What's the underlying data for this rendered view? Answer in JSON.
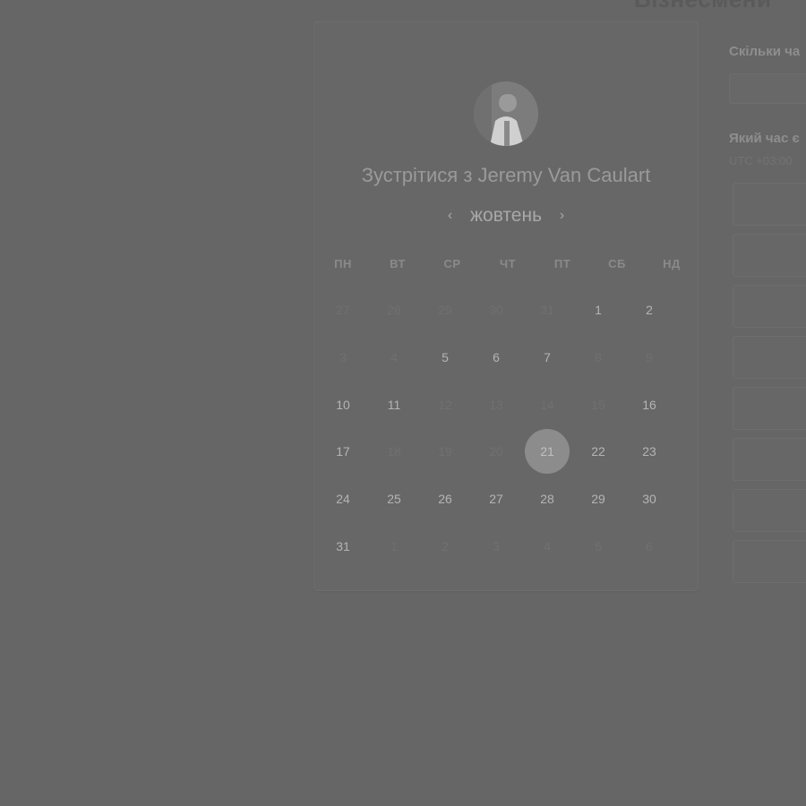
{
  "header": {
    "title": "Бізнесмени"
  },
  "host": {
    "meet_prefix": "Зустрітися з",
    "name": "Jeremy Van Caulart"
  },
  "calendar": {
    "month": "жовтень",
    "prev_icon": "chevron-left-icon",
    "next_icon": "chevron-right-icon",
    "weekdays": [
      "ПН",
      "ВТ",
      "СР",
      "ЧТ",
      "ПТ",
      "СБ",
      "НД"
    ],
    "selected_day": "21",
    "weeks": [
      [
        {
          "d": "27",
          "a": false
        },
        {
          "d": "28",
          "a": false
        },
        {
          "d": "29",
          "a": false
        },
        {
          "d": "30",
          "a": false
        },
        {
          "d": "31",
          "a": false
        },
        {
          "d": "1",
          "a": true
        },
        {
          "d": "2",
          "a": true
        }
      ],
      [
        {
          "d": "3",
          "a": false
        },
        {
          "d": "4",
          "a": false
        },
        {
          "d": "5",
          "a": true
        },
        {
          "d": "6",
          "a": true
        },
        {
          "d": "7",
          "a": true
        },
        {
          "d": "8",
          "a": false
        },
        {
          "d": "9",
          "a": false
        }
      ],
      [
        {
          "d": "10",
          "a": true
        },
        {
          "d": "11",
          "a": true
        },
        {
          "d": "12",
          "a": false
        },
        {
          "d": "13",
          "a": false
        },
        {
          "d": "14",
          "a": false
        },
        {
          "d": "15",
          "a": false
        },
        {
          "d": "16",
          "a": true
        }
      ],
      [
        {
          "d": "17",
          "a": true
        },
        {
          "d": "18",
          "a": false
        },
        {
          "d": "19",
          "a": false
        },
        {
          "d": "20",
          "a": false
        },
        {
          "d": "21",
          "a": true
        },
        {
          "d": "22",
          "a": true
        },
        {
          "d": "23",
          "a": true
        }
      ],
      [
        {
          "d": "24",
          "a": true
        },
        {
          "d": "25",
          "a": true
        },
        {
          "d": "26",
          "a": true
        },
        {
          "d": "27",
          "a": true
        },
        {
          "d": "28",
          "a": true
        },
        {
          "d": "29",
          "a": true
        },
        {
          "d": "30",
          "a": true
        }
      ],
      [
        {
          "d": "31",
          "a": true
        },
        {
          "d": "1",
          "a": false
        },
        {
          "d": "2",
          "a": false
        },
        {
          "d": "3",
          "a": false
        },
        {
          "d": "4",
          "a": false
        },
        {
          "d": "5",
          "a": false
        },
        {
          "d": "6",
          "a": false
        }
      ]
    ]
  },
  "booking": {
    "duration_question": "Скільки ча",
    "time_question": "Який час є",
    "timezone": "UTC +03:00"
  },
  "colors": {
    "overlay": "#666666",
    "selected": "#8c8c8c"
  }
}
